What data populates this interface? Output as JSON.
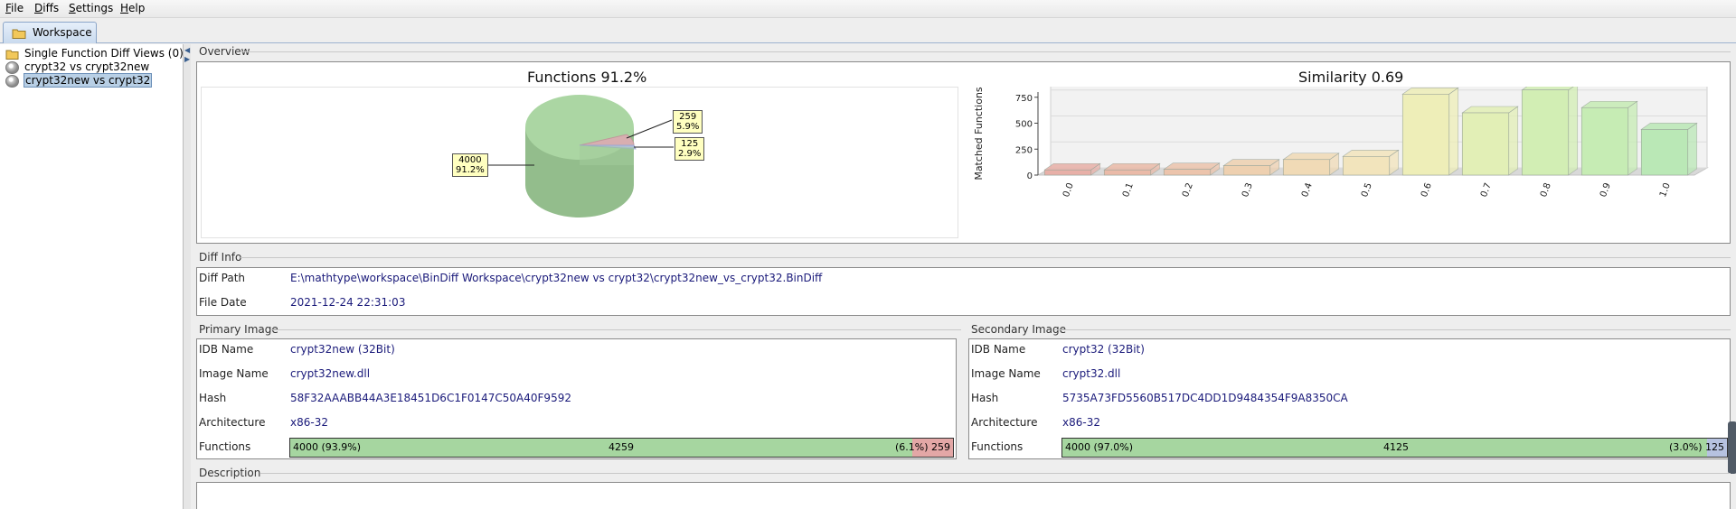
{
  "menu": [
    {
      "mnemonic": "F",
      "rest": "ile"
    },
    {
      "mnemonic": "D",
      "rest": "iffs"
    },
    {
      "mnemonic": "S",
      "rest": "ettings"
    },
    {
      "mnemonic": "H",
      "rest": "elp"
    }
  ],
  "tabs": {
    "workspace": "Workspace"
  },
  "tree": {
    "items": [
      {
        "label": "Single Function Diff Views (0)",
        "icon": "folder-icon"
      },
      {
        "label": "crypt32 vs crypt32new",
        "icon": "disc-icon"
      },
      {
        "label": "crypt32new vs crypt32",
        "icon": "disc-icon",
        "selected": true
      }
    ]
  },
  "overview": {
    "title": "Overview",
    "pie_title": "Functions 91.2%",
    "pie_labels": [
      {
        "line1": "4000",
        "line2": "91.2%"
      },
      {
        "line1": "259",
        "line2": "5.9%"
      },
      {
        "line1": "125",
        "line2": "2.9%"
      }
    ],
    "bar_title": "Similarity 0.69"
  },
  "chart_data": [
    {
      "type": "pie",
      "title": "Functions 91.2%",
      "categories": [
        "matched",
        "primary-unmatched",
        "secondary-unmatched"
      ],
      "values": [
        4000,
        259,
        125
      ],
      "labels": [
        "91.2%",
        "5.9%",
        "2.9%"
      ],
      "colors": [
        "#a8d4a0",
        "#d8a8a4",
        "#a8b4d8"
      ]
    },
    {
      "type": "bar",
      "title": "Similarity 0.69",
      "ylabel": "Matched Functions",
      "xlabel": "",
      "categories": [
        "0.0",
        "0.1",
        "0.2",
        "0.3",
        "0.4",
        "0.5",
        "0.6",
        "0.7",
        "0.8",
        "0.9",
        "1.0"
      ],
      "values": [
        50,
        50,
        55,
        90,
        150,
        180,
        780,
        600,
        820,
        650,
        440
      ],
      "ylim": [
        0,
        800
      ],
      "yticks": [
        0,
        250,
        500,
        750
      ],
      "colors": [
        "#e8b0a8",
        "#eabaa8",
        "#ecc4ac",
        "#eed0b0",
        "#f0dab6",
        "#f2e4bc",
        "#eeeeb8",
        "#e2efb6",
        "#d2eeb4",
        "#c6ecb4",
        "#bae8b6"
      ]
    }
  ],
  "diff_info": {
    "title": "Diff Info",
    "path_label": "Diff Path",
    "path_value": "E:\\mathtype\\workspace\\BinDiff Workspace\\crypt32new vs crypt32\\crypt32new_vs_crypt32.BinDiff",
    "date_label": "File Date",
    "date_value": "2021-12-24 22:31:03"
  },
  "primary": {
    "title": "Primary Image",
    "idb_label": "IDB Name",
    "idb_value": "crypt32new (32Bit)",
    "image_label": "Image Name",
    "image_value": "crypt32new.dll",
    "hash_label": "Hash",
    "hash_value": "58F32AAABB44A3E18451D6C1F0147C50A40F9592",
    "arch_label": "Architecture",
    "arch_value": "x86-32",
    "func_label": "Functions",
    "bar_left": "4000 (93.9%)",
    "bar_mid": "4259",
    "bar_right": "(6.1%) 259",
    "matched_fraction": 0.939
  },
  "secondary": {
    "title": "Secondary Image",
    "idb_label": "IDB Name",
    "idb_value": "crypt32 (32Bit)",
    "image_label": "Image Name",
    "image_value": "crypt32.dll",
    "hash_label": "Hash",
    "hash_value": "5735A73FD5560B517DC4DD1D9484354F9A8350CA",
    "arch_label": "Architecture",
    "arch_value": "x86-32",
    "func_label": "Functions",
    "bar_left": "4000 (97.0%)",
    "bar_mid": "4125",
    "bar_right": "(3.0%) 125",
    "matched_fraction": 0.97
  },
  "description": {
    "title": "Description"
  },
  "colors": {
    "accent": "#b8cfe5",
    "matched": "#a6d6a0",
    "primary_unmatched": "#e3a7a6",
    "secondary_unmatched": "#b6c2e0"
  }
}
